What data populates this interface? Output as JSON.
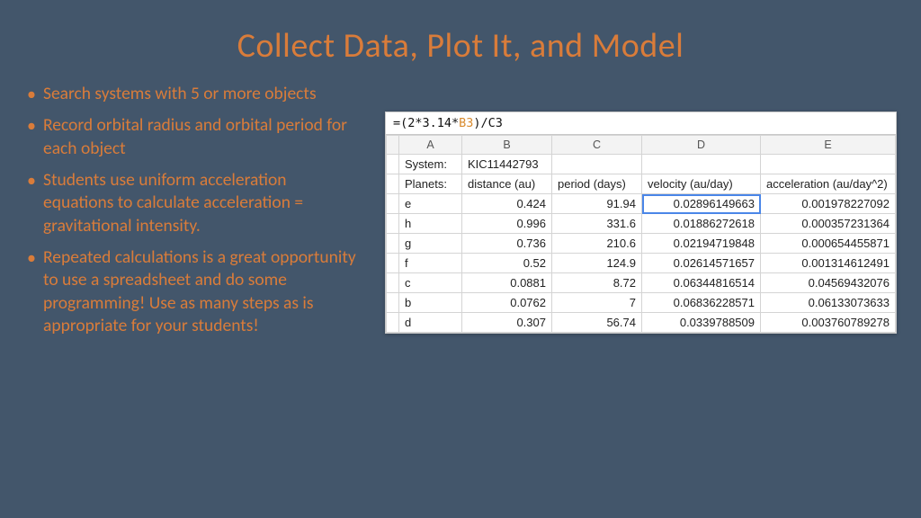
{
  "title": "Collect Data, Plot It, and Model",
  "bullets": [
    "Search systems with 5 or more objects",
    "Record orbital radius and orbital period for each object",
    "Students use uniform acceleration equations to calculate acceleration = gravitational intensity.",
    "Repeated calculations is a great opportunity to use a spreadsheet and do some programming! Use as many steps as is appropriate for your students!"
  ],
  "spreadsheet": {
    "formula_prefix": "=(2*3.14*",
    "formula_ref": "B3",
    "formula_suffix": ")/C3",
    "col_headers": [
      "A",
      "B",
      "C",
      "D",
      "E"
    ],
    "row1": {
      "label": "System:",
      "value": "KIC11442793"
    },
    "row2": {
      "label": "Planets:",
      "b": "distance (au)",
      "c": "period (days)",
      "d": "velocity (au/day)",
      "e": "acceleration (au/day^2)"
    },
    "data_rows": [
      {
        "a": "e",
        "b": "0.424",
        "c": "91.94",
        "d": "0.02896149663",
        "e": "0.001978227092",
        "selected": true
      },
      {
        "a": "h",
        "b": "0.996",
        "c": "331.6",
        "d": "0.01886272618",
        "e": "0.000357231364"
      },
      {
        "a": "g",
        "b": "0.736",
        "c": "210.6",
        "d": "0.02194719848",
        "e": "0.000654455871"
      },
      {
        "a": "f",
        "b": "0.52",
        "c": "124.9",
        "d": "0.02614571657",
        "e": "0.001314612491"
      },
      {
        "a": "c",
        "b": "0.0881",
        "c": "8.72",
        "d": "0.06344816514",
        "e": "0.04569432076"
      },
      {
        "a": "b",
        "b": "0.0762",
        "c": "7",
        "d": "0.06836228571",
        "e": "0.06133073633"
      },
      {
        "a": "d",
        "b": "0.307",
        "c": "56.74",
        "d": "0.0339788509",
        "e": "0.003760789278"
      }
    ]
  },
  "chart_data": {
    "type": "table",
    "title": "KIC11442793 planetary data",
    "columns": [
      "planet",
      "distance (au)",
      "period (days)",
      "velocity (au/day)",
      "acceleration (au/day^2)"
    ],
    "rows": [
      [
        "e",
        0.424,
        91.94,
        0.02896149663,
        0.001978227092
      ],
      [
        "h",
        0.996,
        331.6,
        0.01886272618,
        0.000357231364
      ],
      [
        "g",
        0.736,
        210.6,
        0.02194719848,
        0.000654455871
      ],
      [
        "f",
        0.52,
        124.9,
        0.02614571657,
        0.001314612491
      ],
      [
        "c",
        0.0881,
        8.72,
        0.06344816514,
        0.04569432076
      ],
      [
        "b",
        0.0762,
        7,
        0.06836228571,
        0.06133073633
      ],
      [
        "d",
        0.307,
        56.74,
        0.0339788509,
        0.003760789278
      ]
    ]
  }
}
